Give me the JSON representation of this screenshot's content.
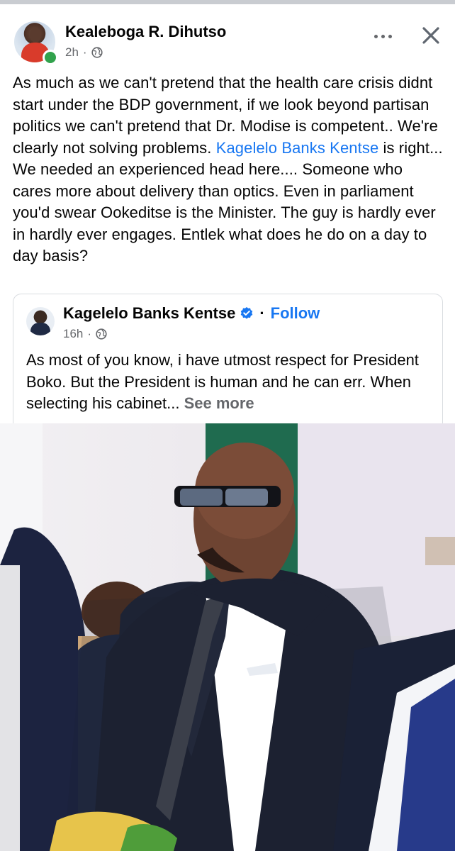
{
  "post": {
    "author": "Kealeboga R. Dihutso",
    "time": "2h",
    "separator": "·",
    "text_parts": [
      "As much as we can't pretend that the health care crisis didnt start under the BDP government, if we look beyond partisan politics we can't pretend that Dr. Modise is competent.. We're clearly not solving problems. ",
      "Kagelelo Banks Kentse",
      " is right... We needed an experienced head here.... Someone who cares more about delivery than optics. Even in parliament you'd swear Ookeditse is the Minister. The guy is hardly ever in hardly ever engages. Entlek what does he do on a day to day basis?"
    ]
  },
  "shared": {
    "author": "Kagelelo Banks Kentse",
    "separator": "·",
    "follow_label": "Follow",
    "time": "16h",
    "text": "As most of you know, i have utmost respect for President Boko. But the President is human and he can err. When selecting his cabinet...",
    "see_more_label": "See more"
  },
  "icons": {
    "more": "more-horizontal-icon",
    "close": "close-icon",
    "audience": "globe-icon",
    "verified": "verified-badge-icon"
  },
  "colors": {
    "link": "#1877f2",
    "secondary_text": "#65676b",
    "online": "#31a24c"
  }
}
